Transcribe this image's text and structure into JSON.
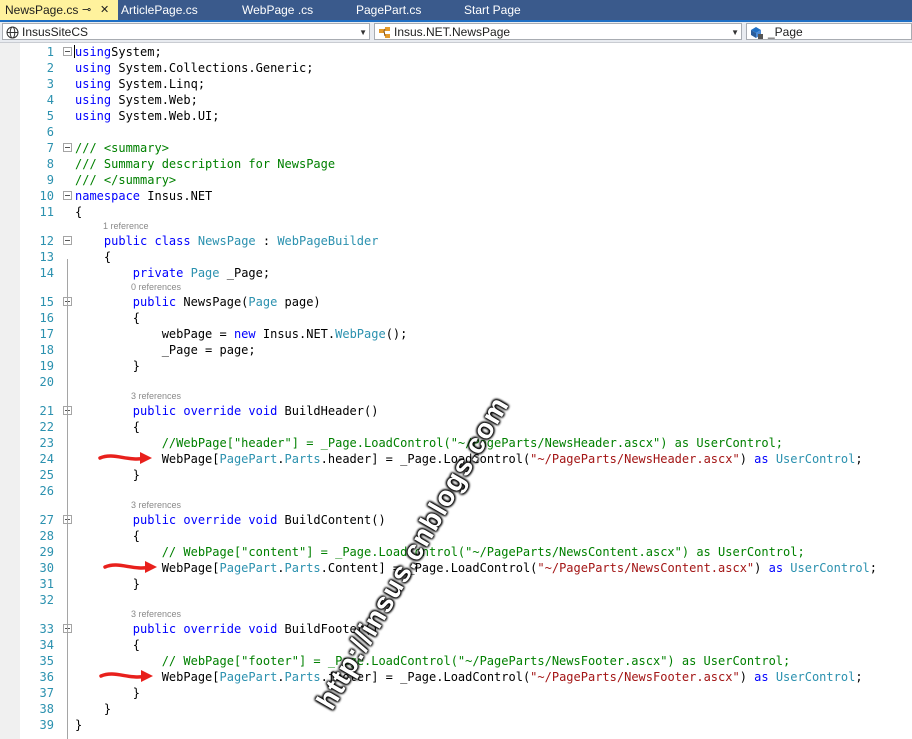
{
  "tabs": [
    {
      "label": "NewsPage.cs",
      "active": true
    },
    {
      "label": "ArticlePage.cs"
    },
    {
      "label": "WebPage .cs"
    },
    {
      "label": "PagePart.cs"
    },
    {
      "label": "Start Page"
    }
  ],
  "tab_pin": "⊸",
  "tab_close": "✕",
  "nav": {
    "project": "InsusSiteCS",
    "type": "Insus.NET.NewsPage",
    "member": "_Page"
  },
  "code_lens": {
    "ref1": "1 reference",
    "ref0": "0 references",
    "ref3": "3 references"
  },
  "watermark": "http://insus.cnblogs.com",
  "colors": {
    "keyword": "#0000ff",
    "type": "#2b91af",
    "comment": "#008000",
    "string": "#a31515",
    "arrow": "#e8201c",
    "tab_active": "#fff29d"
  },
  "code": [
    {
      "n": "1",
      "t": [
        [
          "kw",
          "using"
        ],
        [
          "",
          "System;"
        ]
      ]
    },
    {
      "n": "2",
      "t": [
        [
          "kw",
          "using"
        ],
        [
          "",
          " System.Collections.Generic;"
        ]
      ]
    },
    {
      "n": "3",
      "t": [
        [
          "kw",
          "using"
        ],
        [
          "",
          " System.Linq;"
        ]
      ]
    },
    {
      "n": "4",
      "t": [
        [
          "kw",
          "using"
        ],
        [
          "",
          " System.Web;"
        ]
      ]
    },
    {
      "n": "5",
      "t": [
        [
          "kw",
          "using"
        ],
        [
          "",
          " System.Web.UI;"
        ]
      ]
    },
    {
      "n": "6",
      "t": []
    },
    {
      "n": "7",
      "t": [
        [
          "cm",
          "/// <summary>"
        ]
      ]
    },
    {
      "n": "8",
      "t": [
        [
          "cm",
          "/// Summary description for NewsPage"
        ]
      ]
    },
    {
      "n": "9",
      "t": [
        [
          "cm",
          "/// </summary>"
        ]
      ]
    },
    {
      "n": "10",
      "t": [
        [
          "kw",
          "namespace"
        ],
        [
          "",
          " Insus.NET"
        ]
      ]
    },
    {
      "n": "11",
      "t": [
        [
          "",
          "{"
        ]
      ]
    },
    {
      "n": "12",
      "t": [
        [
          "",
          "    "
        ],
        [
          "kw",
          "public class"
        ],
        [
          "",
          " "
        ],
        [
          "ty",
          "NewsPage"
        ],
        [
          "",
          " : "
        ],
        [
          "ty",
          "WebPageBuilder"
        ]
      ]
    },
    {
      "n": "13",
      "t": [
        [
          "",
          "    {"
        ]
      ]
    },
    {
      "n": "14",
      "t": [
        [
          "",
          "        "
        ],
        [
          "kw",
          "private"
        ],
        [
          "",
          " "
        ],
        [
          "ty",
          "Page"
        ],
        [
          "",
          " _Page;"
        ]
      ]
    },
    {
      "n": "15",
      "t": [
        [
          "",
          "        "
        ],
        [
          "kw",
          "public"
        ],
        [
          "",
          " NewsPage("
        ],
        [
          "ty",
          "Page"
        ],
        [
          "",
          " page)"
        ]
      ]
    },
    {
      "n": "16",
      "t": [
        [
          "",
          "        {"
        ]
      ]
    },
    {
      "n": "17",
      "t": [
        [
          "",
          "            webPage = "
        ],
        [
          "kw",
          "new"
        ],
        [
          "",
          " Insus.NET."
        ],
        [
          "ty",
          "WebPage"
        ],
        [
          "",
          "();"
        ]
      ]
    },
    {
      "n": "18",
      "t": [
        [
          "",
          "            _Page = page;"
        ]
      ]
    },
    {
      "n": "19",
      "t": [
        [
          "",
          "        }"
        ]
      ]
    },
    {
      "n": "20",
      "t": []
    },
    {
      "n": "21",
      "t": [
        [
          "",
          "        "
        ],
        [
          "kw",
          "public override void"
        ],
        [
          "",
          " BuildHeader()"
        ]
      ]
    },
    {
      "n": "22",
      "t": [
        [
          "",
          "        {"
        ]
      ]
    },
    {
      "n": "23",
      "t": [
        [
          "",
          "            "
        ],
        [
          "cm",
          "//WebPage[\"header\"] = _Page.LoadControl(\"~/PageParts/NewsHeader.ascx\") as UserControl;"
        ]
      ]
    },
    {
      "n": "24",
      "t": [
        [
          "",
          "            WebPage["
        ],
        [
          "ty",
          "PagePart"
        ],
        [
          "",
          "."
        ],
        [
          "ty",
          "Parts"
        ],
        [
          "",
          ".header] = _Page.LoadControl("
        ],
        [
          "st",
          "\"~/PageParts/NewsHeader.ascx\""
        ],
        [
          "",
          ") "
        ],
        [
          "kw",
          "as"
        ],
        [
          "",
          " "
        ],
        [
          "ty",
          "UserControl"
        ],
        [
          "",
          ";"
        ]
      ]
    },
    {
      "n": "25",
      "t": [
        [
          "",
          "        }"
        ]
      ]
    },
    {
      "n": "26",
      "t": []
    },
    {
      "n": "27",
      "t": [
        [
          "",
          "        "
        ],
        [
          "kw",
          "public override void"
        ],
        [
          "",
          " BuildContent()"
        ]
      ]
    },
    {
      "n": "28",
      "t": [
        [
          "",
          "        {"
        ]
      ]
    },
    {
      "n": "29",
      "t": [
        [
          "",
          "            "
        ],
        [
          "cm",
          "// WebPage[\"content\"] = _Page.LoadControl(\"~/PageParts/NewsContent.ascx\") as UserControl;"
        ]
      ]
    },
    {
      "n": "30",
      "t": [
        [
          "",
          "            WebPage["
        ],
        [
          "ty",
          "PagePart"
        ],
        [
          "",
          "."
        ],
        [
          "ty",
          "Parts"
        ],
        [
          "",
          ".Content] = _Page.LoadControl("
        ],
        [
          "st",
          "\"~/PageParts/NewsContent.ascx\""
        ],
        [
          "",
          ") "
        ],
        [
          "kw",
          "as"
        ],
        [
          "",
          " "
        ],
        [
          "ty",
          "UserControl"
        ],
        [
          "",
          ";"
        ]
      ]
    },
    {
      "n": "31",
      "t": [
        [
          "",
          "        }"
        ]
      ]
    },
    {
      "n": "32",
      "t": []
    },
    {
      "n": "33",
      "t": [
        [
          "",
          "        "
        ],
        [
          "kw",
          "public override void"
        ],
        [
          "",
          " BuildFooter()"
        ]
      ]
    },
    {
      "n": "34",
      "t": [
        [
          "",
          "        {"
        ]
      ]
    },
    {
      "n": "35",
      "t": [
        [
          "",
          "            "
        ],
        [
          "cm",
          "// WebPage[\"footer\"] = _Page.LoadControl(\"~/PageParts/NewsFooter.ascx\") as UserControl;"
        ]
      ]
    },
    {
      "n": "36",
      "t": [
        [
          "",
          "            WebPage["
        ],
        [
          "ty",
          "PagePart"
        ],
        [
          "",
          "."
        ],
        [
          "ty",
          "Parts"
        ],
        [
          "",
          ".footer] = _Page.LoadControl("
        ],
        [
          "st",
          "\"~/PageParts/NewsFooter.ascx\""
        ],
        [
          "",
          ") "
        ],
        [
          "kw",
          "as"
        ],
        [
          "",
          " "
        ],
        [
          "ty",
          "UserControl"
        ],
        [
          "",
          ";"
        ]
      ]
    },
    {
      "n": "37",
      "t": [
        [
          "",
          "        }"
        ]
      ]
    },
    {
      "n": "38",
      "t": [
        [
          "",
          "    }"
        ]
      ]
    },
    {
      "n": "39",
      "t": [
        [
          "",
          "}"
        ]
      ]
    }
  ]
}
